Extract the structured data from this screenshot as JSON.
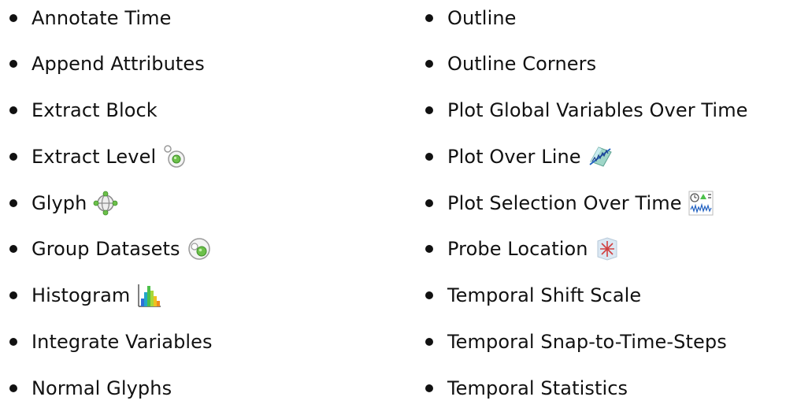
{
  "left_column": [
    {
      "label": "Annotate Time",
      "icon": null
    },
    {
      "label": "Append Attributes",
      "icon": null
    },
    {
      "label": "Extract Block",
      "icon": null
    },
    {
      "label": "Extract Level",
      "icon": "extract-level-icon"
    },
    {
      "label": "Glyph",
      "icon": "glyph-icon"
    },
    {
      "label": "Group Datasets",
      "icon": "group-datasets-icon"
    },
    {
      "label": "Histogram",
      "icon": "histogram-icon"
    },
    {
      "label": "Integrate Variables",
      "icon": null
    },
    {
      "label": "Normal Glyphs",
      "icon": null
    }
  ],
  "right_column": [
    {
      "label": "Outline",
      "icon": null
    },
    {
      "label": "Outline Corners",
      "icon": null
    },
    {
      "label": "Plot Global Variables Over Time",
      "icon": null
    },
    {
      "label": "Plot Over Line",
      "icon": "plot-over-line-icon"
    },
    {
      "label": "Plot Selection Over Time",
      "icon": "plot-selection-over-time-icon"
    },
    {
      "label": "Probe Location",
      "icon": "probe-location-icon"
    },
    {
      "label": "Temporal Shift Scale",
      "icon": null
    },
    {
      "label": "Temporal Snap-to-Time-Steps",
      "icon": null
    },
    {
      "label": "Temporal Statistics",
      "icon": null
    }
  ]
}
